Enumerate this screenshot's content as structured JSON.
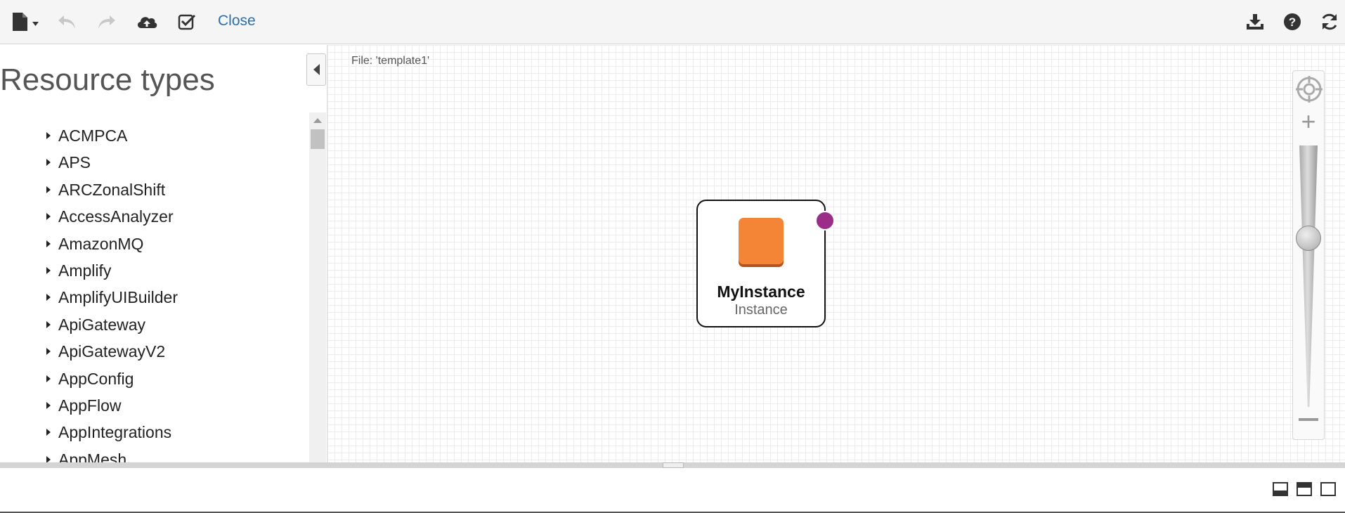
{
  "toolbar": {
    "close_label": "Close"
  },
  "left_panel": {
    "title": "Resource types",
    "items": [
      "ACMPCA",
      "APS",
      "ARCZonalShift",
      "AccessAnalyzer",
      "AmazonMQ",
      "Amplify",
      "AmplifyUIBuilder",
      "ApiGateway",
      "ApiGatewayV2",
      "AppConfig",
      "AppFlow",
      "AppIntegrations",
      "AppMesh"
    ]
  },
  "canvas": {
    "file_label": "File: 'template1'",
    "node": {
      "name": "MyInstance",
      "type": "Instance",
      "icon_color": "#f58536",
      "port_color": "#9b2d8a"
    }
  },
  "colors": {
    "link": "#2b6fb0",
    "toolbar_bg": "#f5f5f5"
  }
}
